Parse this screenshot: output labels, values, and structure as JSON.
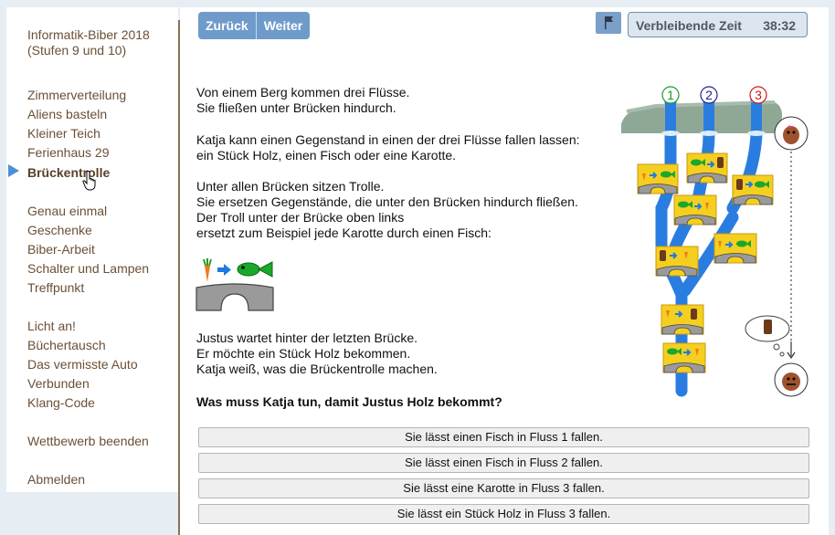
{
  "sidebar": {
    "title_line1": "Informatik-Biber 2018",
    "title_line2": "(Stufen 9 und 10)",
    "items": [
      {
        "label": "Zimmerverteilung"
      },
      {
        "label": "Aliens basteln"
      },
      {
        "label": "Kleiner Teich"
      },
      {
        "label": "Ferienhaus 29"
      },
      {
        "label": "Brückentrolle"
      },
      {
        "label": "Genau einmal"
      },
      {
        "label": "Geschenke"
      },
      {
        "label": "Biber-Arbeit"
      },
      {
        "label": "Schalter und Lampen"
      },
      {
        "label": "Treffpunkt"
      },
      {
        "label": "Licht an!"
      },
      {
        "label": "Büchertausch"
      },
      {
        "label": "Das vermisste Auto"
      },
      {
        "label": "Verbunden"
      },
      {
        "label": "Klang-Code"
      }
    ],
    "end_contest": "Wettbewerb beenden",
    "logout": "Abmelden"
  },
  "toolbar": {
    "back_label": "Zurück",
    "next_label": "Weiter",
    "timer_label": "Verbleibende Zeit",
    "timer_value": "38:32"
  },
  "task": {
    "p1_l1": "Von einem Berg kommen drei Flüsse.",
    "p1_l2": "Sie fließen unter Brücken hindurch.",
    "p2_l1": "Katja kann einen Gegenstand in einen der drei Flüsse fallen lassen:",
    "p2_l2": "ein Stück Holz, einen Fisch oder eine Karotte.",
    "p3_l1": "Unter allen Brücken sitzen Trolle.",
    "p3_l2": "Sie ersetzen Gegenstände, die unter den Brücken hindurch fließen.",
    "p3_l3": "Der Troll unter der Brücke oben links",
    "p3_l4": "ersetzt zum Beispiel jede Karotte durch einen Fisch:",
    "p4_l1": "Justus wartet hinter der letzten Brücke.",
    "p4_l2": "Er möchte ein Stück Holz bekommen.",
    "p4_l3": "Katja weiß, was die Brückentrolle machen.",
    "question": "Was muss Katja tun, damit Justus Holz bekommt?",
    "river_labels": [
      "1",
      "2",
      "3"
    ]
  },
  "answers": [
    {
      "label": "Sie lässt einen Fisch in Fluss 1 fallen."
    },
    {
      "label": "Sie lässt einen Fisch in Fluss 2 fallen."
    },
    {
      "label": "Sie lässt eine Karotte in Fluss 3 fallen."
    },
    {
      "label": "Sie lässt ein Stück Holz in Fluss 3 fallen."
    }
  ],
  "colors": {
    "accent": "#6f9bcb",
    "nav_text": "#6b4f35",
    "active_arrow": "#4a8fd8",
    "river": "#2a7de0",
    "river1": "#1a9a2a",
    "river2": "#22228a",
    "river3": "#d01818"
  }
}
